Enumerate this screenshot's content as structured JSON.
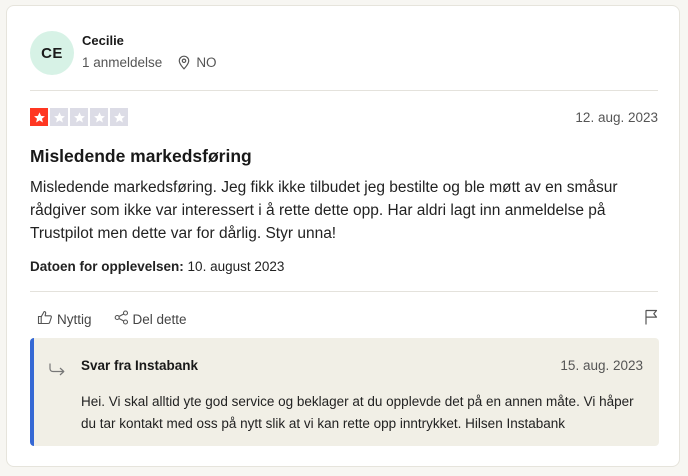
{
  "reviewer": {
    "initials": "CE",
    "name": "Cecilie",
    "review_count": "1 anmeldelse",
    "country": "NO"
  },
  "review": {
    "rating": 1,
    "max_rating": 5,
    "date": "12. aug. 2023",
    "title": "Misledende markedsføring",
    "body": "Misledende markedsføring. Jeg fikk ikke tilbudet jeg bestilte og ble møtt av en småsur rådgiver som ikke var interessert i å rette dette opp. Har aldri lagt inn anmeldelse på Trustpilot men dette var for dårlig. Styr unna!",
    "experience_label": "Datoen for opplevelsen:",
    "experience_date": "10. august 2023"
  },
  "actions": {
    "helpful_label": "Nyttig",
    "share_label": "Del dette"
  },
  "reply": {
    "title": "Svar fra Instabank",
    "date": "15. aug. 2023",
    "body": "Hei. Vi skal alltid yte god service og beklager at du opplevde det på en annen måte. Vi håper du tar kontakt med oss på nytt slik at vi kan rette opp inntrykket. Hilsen Instabank"
  },
  "colors": {
    "star_filled": "#ff3722",
    "star_empty": "#dcdce6",
    "reply_accent": "#3568d4",
    "avatar_bg": "#d7f2e6"
  }
}
